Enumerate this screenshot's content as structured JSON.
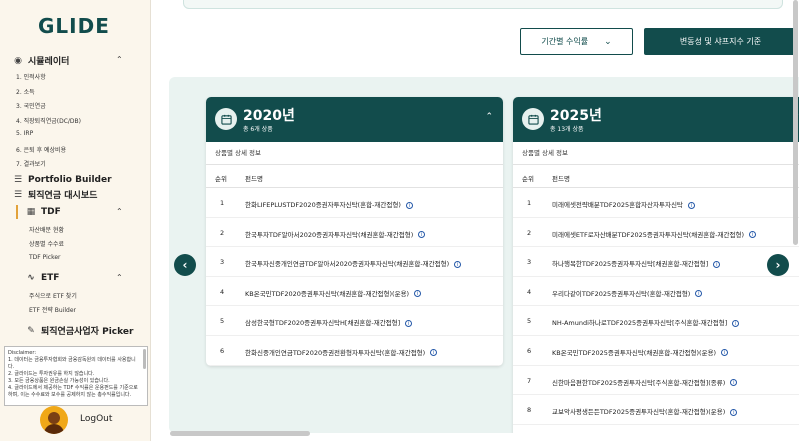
{
  "sidebar": {
    "logo": "GLIDE",
    "simulator": {
      "label": "시뮬레이터",
      "steps": [
        "1. 인적사항",
        "2. 소득",
        "3. 국민연금",
        "4. 직장퇴직연금(DC/DB)",
        "5. IRP",
        "6. 은퇴 후 예상비용",
        "7. 결과보기"
      ]
    },
    "portfolio_builder": "Portfolio Builder",
    "dashboard": "퇴직연금 대시보드",
    "tdf": {
      "label": "TDF",
      "items": [
        "자산배분 현황",
        "상품별 수수료",
        "TDF Picker"
      ]
    },
    "etf": {
      "label": "ETF",
      "items": [
        "주식으로 ETF 찾기",
        "ETF 전략 Builder"
      ]
    },
    "picker": "퇴직연금사업자 Picker",
    "disclaimer": "Disclaimer:\n1. 데이터는 금융투자협회와 금융감독원의 데이터를 사용합니다.\n2. 글라이드는 투자권유를 하지 않습니다.\n3. 모든 금융상품은 원금손실 가능성이 있습니다.\n4. 글라이드에서 제공하는 TDF 수익률은 운용펀드를 기준으로 하며, 이는 수수료와 보수를 공제하지 않는 총수익률입니다.",
    "logout": "LogOut"
  },
  "toolbar": {
    "period_label": "기간별 수익률",
    "volatility_label": "변동성 및 샤프지수 기준"
  },
  "cards": [
    {
      "year": "2020년",
      "count": "총 6개 상품",
      "info_title": "상품별 상세 정보",
      "col_no": "순위",
      "col_name": "펀드명",
      "rows": [
        {
          "no": "1",
          "name": "한화LIFEPLUSTDF2020증권자투자신탁(혼합-재간접형)"
        },
        {
          "no": "2",
          "name": "한국투자TDF알아서2020증권자투자신탁(채권혼합-재간접형)"
        },
        {
          "no": "3",
          "name": "한국투자신중개인연금TDF알아서2020증권자투자신탁(채권혼합-재간접형)"
        },
        {
          "no": "4",
          "name": "KB온국민TDF2020증권투자신탁(채권혼합-재간접형)(운용)"
        },
        {
          "no": "5",
          "name": "삼성한국형TDF2020증권투자신탁H[채권혼합-재간접형]"
        },
        {
          "no": "6",
          "name": "한화신중개인연금TDF2020증권전환형자투자신탁(혼합-재간접형)"
        }
      ]
    },
    {
      "year": "2025년",
      "count": "총 13개 상품",
      "info_title": "상품별 상세 정보",
      "col_no": "순위",
      "col_name": "펀드명",
      "rows": [
        {
          "no": "1",
          "name": "미래에셋전략배분TDF2025혼합자산자투자신탁"
        },
        {
          "no": "2",
          "name": "미래에셋ETF로자산배분TDF2025증권자투자신탁(채권혼합-재간접형)"
        },
        {
          "no": "3",
          "name": "하나행복한TDF2025증권자투자신탁[채권혼합-재간접형]"
        },
        {
          "no": "4",
          "name": "우리다같이TDF2025증권투자신탁(혼합-재간접형)"
        },
        {
          "no": "5",
          "name": "NH-Amundi하나로TDF2025증권투자신탁[주식혼합-재간접형]"
        },
        {
          "no": "6",
          "name": "KB온국민TDF2025증권투자신탁(채권혼합-재간접형)(운용)"
        },
        {
          "no": "7",
          "name": "신한마음편한TDF2025증권투자신탁[주식혼합-재간접형](종류)"
        },
        {
          "no": "8",
          "name": "교보악사평생든든TDF2025증권투자신탁(혼합-재간접형)(운용)"
        }
      ]
    }
  ],
  "colors": {
    "primary": "#124c4c",
    "accent": "#e2a23a",
    "panel_bg": "#eaf3f1",
    "sidebar_bg": "#fbf6ec"
  }
}
